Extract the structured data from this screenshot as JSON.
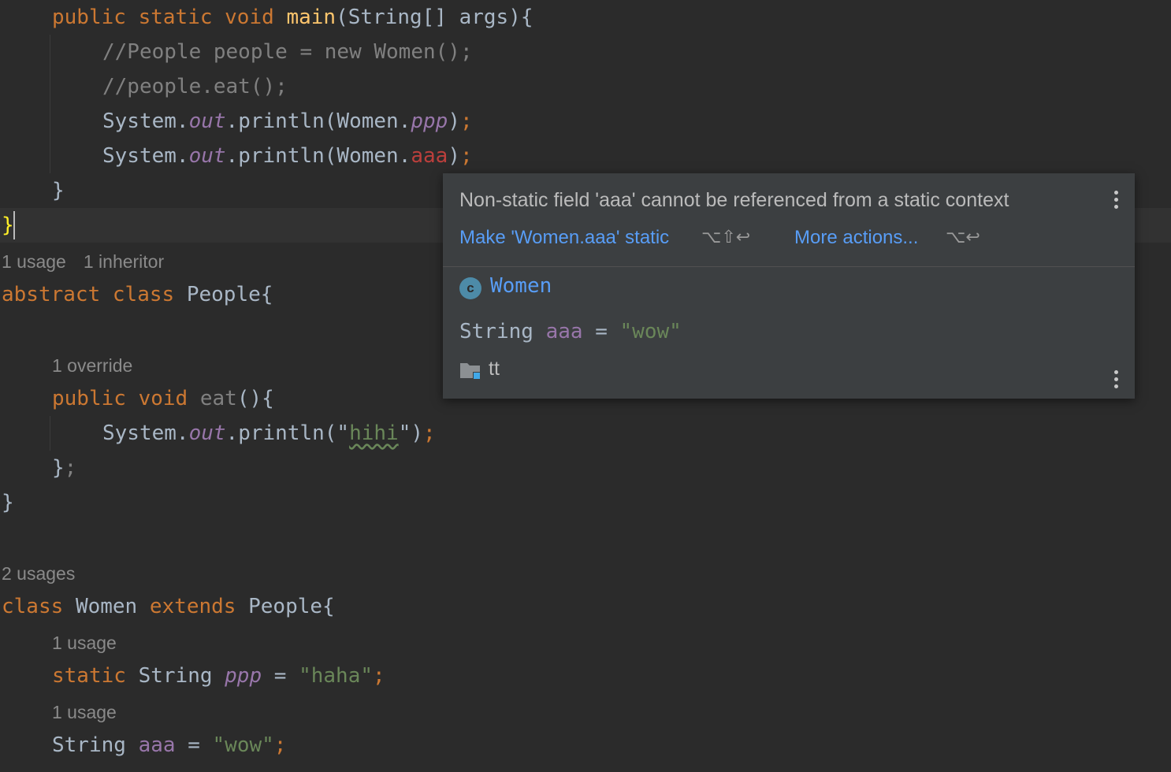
{
  "code": {
    "main_sig": {
      "kw1": "public",
      "kw2": "static",
      "kw3": "void",
      "name": "main",
      "params": "(String[] args){"
    },
    "comment1": "//People people = new Women();",
    "comment2": "//people.eat();",
    "println_ppp": {
      "prefix": "System.",
      "out": "out",
      "mid": ".println(Women.",
      "field": "ppp",
      "close": ")",
      "semi": ";"
    },
    "println_aaa": {
      "prefix": "System.",
      "out": "out",
      "mid": ".println(Women.",
      "field": "aaa",
      "close": ")",
      "semi": ";"
    },
    "close_method": "}",
    "close_class": "}",
    "hint_people_usage": "1 usage",
    "hint_people_inheritor": "1 inheritor",
    "people_decl": {
      "kw1": "abstract",
      "kw2": "class",
      "name": "People{"
    },
    "hint_override": "1 override",
    "eat_decl": {
      "kw1": "public",
      "kw2": "void",
      "name": "eat",
      "rest": "(){"
    },
    "println_hihi": {
      "prefix": "System.",
      "out": "out",
      "mid": ".println(\"",
      "str": "hihi",
      "close": "\")",
      "semi": ";"
    },
    "close_eat": "}",
    "close_eat_semi": ";",
    "close_people": "}",
    "hint_women_usages": "2 usages",
    "women_decl": {
      "kw1": "class",
      "name": "Women",
      "kw2": "extends",
      "parent": "People{"
    },
    "hint_ppp_usage": "1 usage",
    "ppp_decl": {
      "kw": "static",
      "type": "String",
      "name": "ppp",
      "eq": " = ",
      "value": "\"haha\"",
      "semi": ";"
    },
    "hint_aaa_usage": "1 usage",
    "aaa_decl": {
      "type": "String",
      "name": "aaa",
      "eq": " = ",
      "value": "\"wow\"",
      "semi": ";"
    }
  },
  "popup": {
    "message": "Non-static field 'aaa' cannot be referenced from a static context",
    "action_primary": "Make 'Women.aaa' static",
    "action_primary_shortcut": "⌥⇧↩",
    "action_more": "More actions...",
    "action_more_shortcut": "⌥↩",
    "class_icon_letter": "c",
    "class_name": "Women",
    "decl_type": "String",
    "decl_name": "aaa",
    "decl_eq": " = ",
    "decl_value": "\"wow\"",
    "package_name": "tt"
  },
  "colors": {
    "background": "#2b2b2b",
    "keyword": "#cc7832",
    "string": "#6a8759",
    "field": "#9876aa",
    "error": "#bc3f3c",
    "link": "#589df6"
  }
}
